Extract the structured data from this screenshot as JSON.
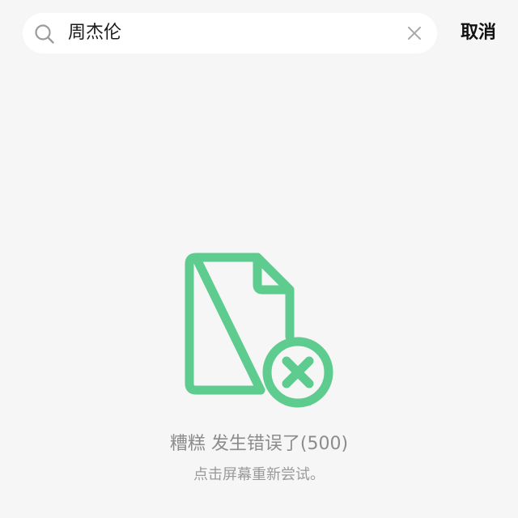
{
  "search": {
    "query": "周杰伦"
  },
  "header": {
    "cancel_label": "取消"
  },
  "error": {
    "title": "糟糕 发生错误了(500)",
    "hint": "点击屏幕重新尝试。"
  },
  "icons": {
    "search": "search-icon",
    "clear": "close-icon",
    "error": "file-error-icon"
  },
  "colors": {
    "accent": "#5ecb8f",
    "background": "#f6f6f6",
    "muted_text": "#8c8c8c"
  }
}
